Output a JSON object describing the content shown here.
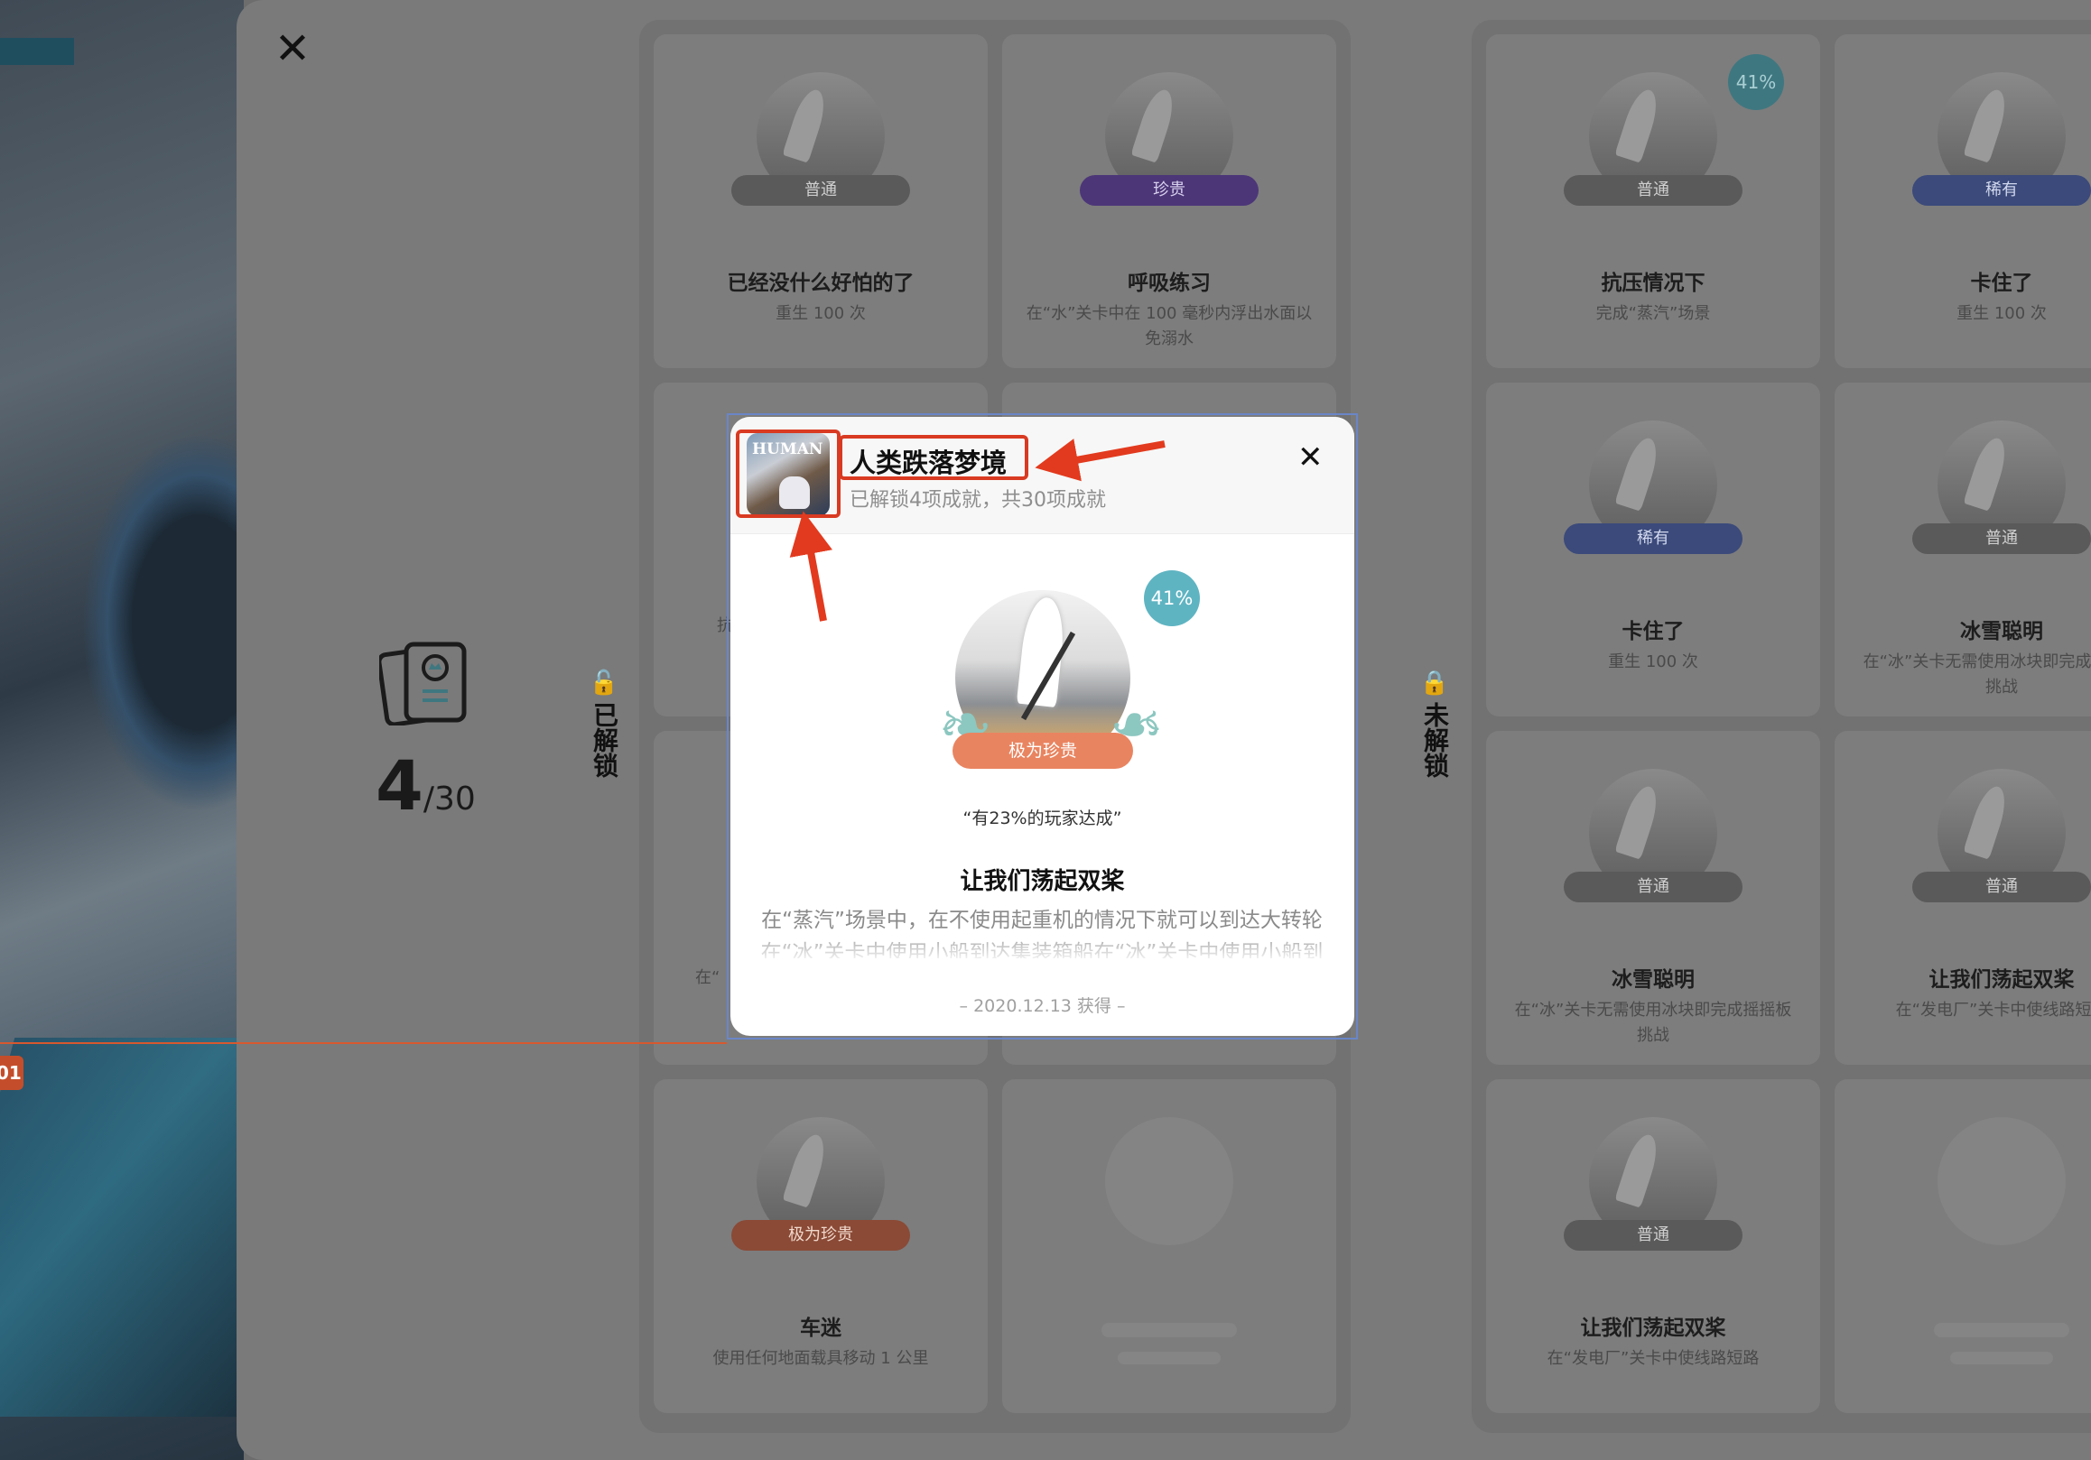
{
  "summary": {
    "unlocked": "4",
    "total": "/30"
  },
  "labels": {
    "unlocked": "已解锁",
    "locked": "未解锁"
  },
  "icons": {
    "close": "✕",
    "lock": "🔒",
    "unlock": "🔓",
    "laurel": "❧"
  },
  "side_tag": "01",
  "unlocked_cards": [
    {
      "badge": "普通",
      "title": "已经没什么好怕的了",
      "desc": "重生 100 次"
    },
    {
      "badge": "珍贵",
      "title": "呼吸练习",
      "desc": "在“水”关卡中在 100 毫秒内浮出水面以免溺水"
    },
    {
      "badge": "极为珍贵",
      "title": "车迷",
      "desc": "使用任何地面载具移动 1 公里"
    }
  ],
  "partial_texts": {
    "left_col_row2": "抗",
    "left_col_row3": "在“"
  },
  "locked_cards": [
    {
      "badge": "普通",
      "title": "抗压情况下",
      "desc": "完成“蒸汽”场景",
      "pct": "41%"
    },
    {
      "badge": "稀有",
      "title": "卡住了",
      "desc": "重生 100 次"
    },
    {
      "badge": "稀有",
      "title": "卡住了",
      "desc": "重生 100 次"
    },
    {
      "badge": "普通",
      "title": "冰雪聪明",
      "desc": "在“冰”关卡无需使用冰块即完成摇摇板挑战"
    },
    {
      "badge": "普通",
      "title": "冰雪聪明",
      "desc": "在“冰”关卡无需使用冰块即完成摇摇板挑战"
    },
    {
      "badge": "普通",
      "title": "让我们荡起双桨",
      "desc": "在“发电厂”关卡中使线路短路"
    },
    {
      "badge": "普通",
      "title": "让我们荡起双桨",
      "desc": "在“发电厂”关卡中使线路短路"
    }
  ],
  "modal": {
    "game_logo": "HUMAN",
    "game_name": "人类跌落梦境",
    "game_progress": "已解锁4项成就，共30项成就",
    "close": "✕",
    "pct": "41%",
    "badge": "极为珍贵",
    "quote": "“有23%的玩家达成”",
    "achievement_title": "让我们荡起双桨",
    "achievement_desc": "在“蒸汽”场景中，在不使用起重机的情况下就可以到达大转轮在“冰”关卡中使用小船到达集装箱船在“冰”关卡中使用小船到",
    "date": "– 2020.12.13 获得 –"
  },
  "colors": {
    "overlay": "#7a7a7a",
    "accent_red": "#e23a1e",
    "badge_ultra": "#e98460",
    "pct_teal": "#5fb4c2"
  }
}
